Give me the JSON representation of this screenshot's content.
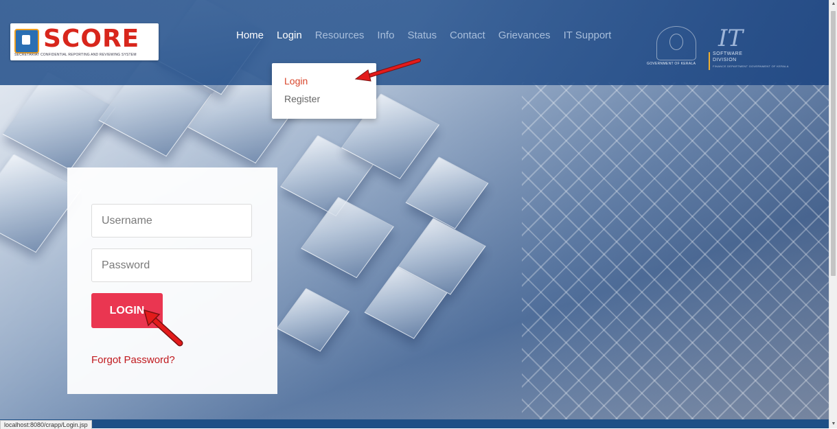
{
  "logo": {
    "title": "SCORE",
    "subtitle": "SECRETARIAT CONFIDENTIAL REPORTING AND REVIEWING SYSTEM"
  },
  "nav": {
    "items": [
      {
        "label": "Home"
      },
      {
        "label": "Login"
      },
      {
        "label": "Resources"
      },
      {
        "label": "Info"
      },
      {
        "label": "Status"
      },
      {
        "label": "Contact"
      },
      {
        "label": "Grievances"
      },
      {
        "label": "IT Support"
      }
    ]
  },
  "dropdown": {
    "items": [
      {
        "label": "Login"
      },
      {
        "label": "Register"
      }
    ]
  },
  "gov": {
    "label": "GOVERNMENT OF KERALA"
  },
  "it_logo": {
    "mark": "IT",
    "line1": "SOFTWARE",
    "line2": "DIVISION",
    "line3": "FINANCE DEPARTMENT GOVERNMENT OF KERALA"
  },
  "login": {
    "username_placeholder": "Username",
    "password_placeholder": "Password",
    "button_label": "LOGIN",
    "forgot_label": "Forgot Password?"
  },
  "status_bar": {
    "url": "localhost:8080/crapp/Login.jsp"
  },
  "colors": {
    "header": "#2a5590",
    "login_button": "#ea3651",
    "forgot_link": "#c0181c",
    "dropdown_active": "#d8452a",
    "arrow": "#e31b1b"
  }
}
